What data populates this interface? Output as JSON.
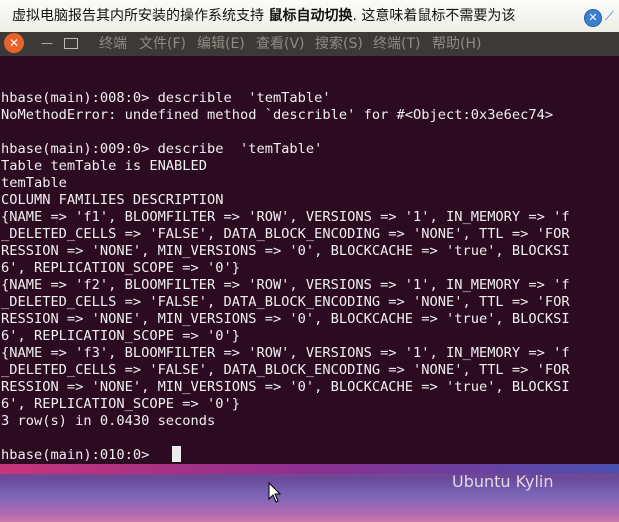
{
  "notification": {
    "text_before": "虚拟电脑报告其内所安装的操作系统支持",
    "text_bold": "鼠标自动切换",
    "text_after": ". 这意味着鼠标不需要为该"
  },
  "menubar": {
    "items": [
      "终端",
      "文件(F)",
      "编辑(E)",
      "查看(V)",
      "搜索(S)",
      "终端(T)",
      "帮助(H)"
    ]
  },
  "terminal": {
    "lines": [
      "hbase(main):008:0> describle  'temTable'",
      "NoMethodError: undefined method `describle' for #<Object:0x3e6ec74>",
      "",
      "hbase(main):009:0> describe  'temTable'",
      "Table temTable is ENABLED",
      "temTable",
      "COLUMN FAMILIES DESCRIPTION",
      "{NAME => 'f1', BLOOMFILTER => 'ROW', VERSIONS => '1', IN_MEMORY => 'f",
      "_DELETED_CELLS => 'FALSE', DATA_BLOCK_ENCODING => 'NONE', TTL => 'FOR",
      "RESSION => 'NONE', MIN_VERSIONS => '0', BLOCKCACHE => 'true', BLOCKSI",
      "6', REPLICATION_SCOPE => '0'}",
      "{NAME => 'f2', BLOOMFILTER => 'ROW', VERSIONS => '1', IN_MEMORY => 'f",
      "_DELETED_CELLS => 'FALSE', DATA_BLOCK_ENCODING => 'NONE', TTL => 'FOR",
      "RESSION => 'NONE', MIN_VERSIONS => '0', BLOCKCACHE => 'true', BLOCKSI",
      "6', REPLICATION_SCOPE => '0'}",
      "{NAME => 'f3', BLOOMFILTER => 'ROW', VERSIONS => '1', IN_MEMORY => 'f",
      "_DELETED_CELLS => 'FALSE', DATA_BLOCK_ENCODING => 'NONE', TTL => 'FOR",
      "RESSION => 'NONE', MIN_VERSIONS => '0', BLOCKCACHE => 'true', BLOCKSI",
      "6', REPLICATION_SCOPE => '0'}",
      "3 row(s) in 0.0430 seconds",
      "",
      "hbase(main):010:0>"
    ]
  },
  "desktop": {
    "watermark": "Ubuntu Kylin"
  },
  "colors": {
    "terminal_bg": "#2c0a22",
    "terminal_fg": "#f0f0f0",
    "menubar_bg": "#3b3a36",
    "close_button": "#e8622c"
  },
  "icons": [
    "close-icon",
    "minimize-icon",
    "maximize-icon",
    "mouse-pointer-icon"
  ]
}
